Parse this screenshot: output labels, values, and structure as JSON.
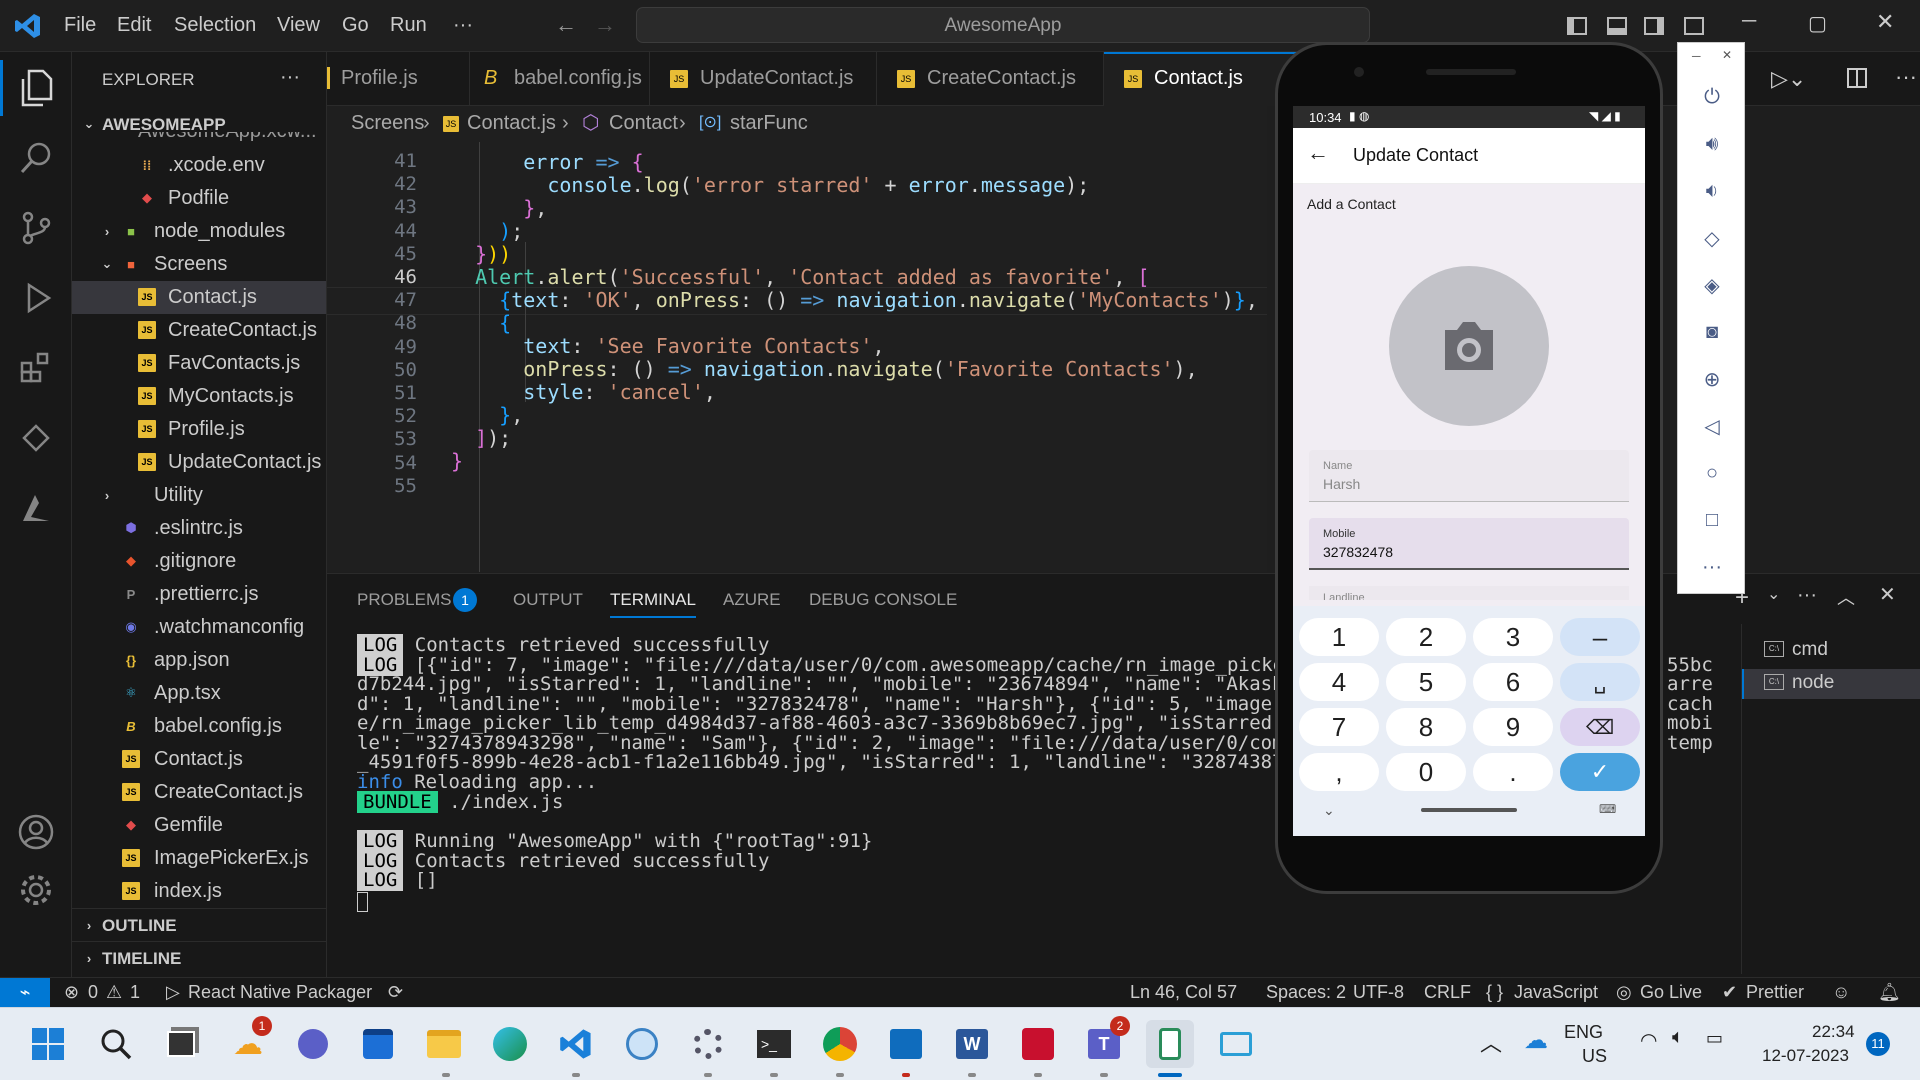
{
  "menu": [
    "File",
    "Edit",
    "Selection",
    "View",
    "Go",
    "Run",
    "···"
  ],
  "search_title": "AwesomeApp",
  "explorer": {
    "title": "EXPLORER",
    "more": "···",
    "root": "AWESOMEAPP",
    "partial": "AwesomeApp.xcw...",
    "items": [
      {
        "label": ".xcode.env"
      },
      {
        "label": "Podfile"
      },
      {
        "label": "node_modules"
      },
      {
        "label": "Screens"
      },
      {
        "label": "Contact.js"
      },
      {
        "label": "CreateContact.js"
      },
      {
        "label": "FavContacts.js"
      },
      {
        "label": "MyContacts.js"
      },
      {
        "label": "Profile.js"
      },
      {
        "label": "UpdateContact.js"
      },
      {
        "label": "Utility"
      },
      {
        "label": ".eslintrc.js"
      },
      {
        "label": ".gitignore"
      },
      {
        "label": ".prettierrc.js"
      },
      {
        "label": ".watchmanconfig"
      },
      {
        "label": "app.json"
      },
      {
        "label": "App.tsx"
      },
      {
        "label": "babel.config.js"
      },
      {
        "label": "Contact.js"
      },
      {
        "label": "CreateContact.js"
      },
      {
        "label": "Gemfile"
      },
      {
        "label": "ImagePickerEx.js"
      },
      {
        "label": "index.js"
      }
    ],
    "outline": "OUTLINE",
    "timeline": "TIMELINE"
  },
  "tabs": [
    {
      "label": "Profile.js"
    },
    {
      "label": "babel.config.js"
    },
    {
      "label": "UpdateContact.js"
    },
    {
      "label": "CreateContact.js"
    },
    {
      "label": "Contact.js"
    }
  ],
  "breadcrumb": [
    "Screens",
    "Contact.js",
    "Contact",
    "starFunc"
  ],
  "editor": {
    "line_numbers": [
      "41",
      "42",
      "43",
      "44",
      "45",
      "46",
      "47",
      "48",
      "49",
      "50",
      "51",
      "52",
      "53",
      "54",
      "55"
    ]
  },
  "panel": {
    "tabs": [
      "PROBLEMS",
      "OUTPUT",
      "TERMINAL",
      "AZURE",
      "DEBUG CONSOLE"
    ],
    "problems_count": "1",
    "terminals": [
      "cmd",
      "node"
    ],
    "lines": [
      "Contacts retrieved successfully",
      "[{\"id\": 7, \"image\": \"file:///data/user/0/com.awesomeapp/cache/rn_image_picker",
      "d7b244.jpg\", \"isStarred\": 1, \"landline\": \"\", \"mobile\": \"23674894\", \"name\": \"Akash K",
      "d\": 1, \"landline\": \"\", \"mobile\": \"327832478\", \"name\": \"Harsh\"}, {\"id\": 5, \"image\":",
      "e/rn_image_picker_lib_temp_d4984d37-af88-4603-a3c7-3369b8b69ec7.jpg\", \"isStarred\":",
      "le\": \"3274378943298\", \"name\": \"Sam\"}, {\"id\": 2, \"image\": \"file:///data/user/0/com.a",
      "_4591f0f5-899b-4e28-acb1-f1a2e116bb49.jpg\", \"isStarred\": 1, \"landline\": \"32874387\",",
      "Reloading app...",
      "./index.js",
      "Running \"AwesomeApp\" with {\"rootTag\":91}",
      "Contacts retrieved successfully",
      "[]"
    ],
    "right_overflow": [
      "55bc",
      "arre",
      "cach",
      "mobi",
      "temp"
    ],
    "log_tag": "LOG",
    "info_tag": "info",
    "bundle_tag": "BUNDLE"
  },
  "status": {
    "errors": "0",
    "warnings": "1",
    "packager": "React Native Packager",
    "position": "Ln 46, Col 57",
    "spaces": "Spaces: 2",
    "encoding": "UTF-8",
    "eol": "CRLF",
    "language": "JavaScript",
    "golive": "Go Live",
    "prettier": "Prettier"
  },
  "phone": {
    "time": "10:34",
    "title": "Update Contact",
    "subtitle": "Add a Contact",
    "name_label": "Name",
    "name_value": "Harsh",
    "mobile_label": "Mobile",
    "mobile_value": "327832478",
    "landline_label": "Landline",
    "keys": [
      "1",
      "2",
      "3",
      "–",
      "4",
      "5",
      "6",
      "␣",
      "7",
      "8",
      "9",
      "⌫",
      ",",
      "0",
      ".",
      "✓"
    ]
  },
  "taskbar": {
    "lang": "ENG",
    "region": "US",
    "time": "22:34",
    "date": "12-07-2023",
    "notif": "11",
    "badge_weather": "1",
    "badge_teams": "2"
  },
  "colors": {
    "accent": "#0078d4",
    "keyword": "#569cd6",
    "string": "#ce9178",
    "function": "#dcdcaa",
    "variable": "#9cdcfe"
  }
}
